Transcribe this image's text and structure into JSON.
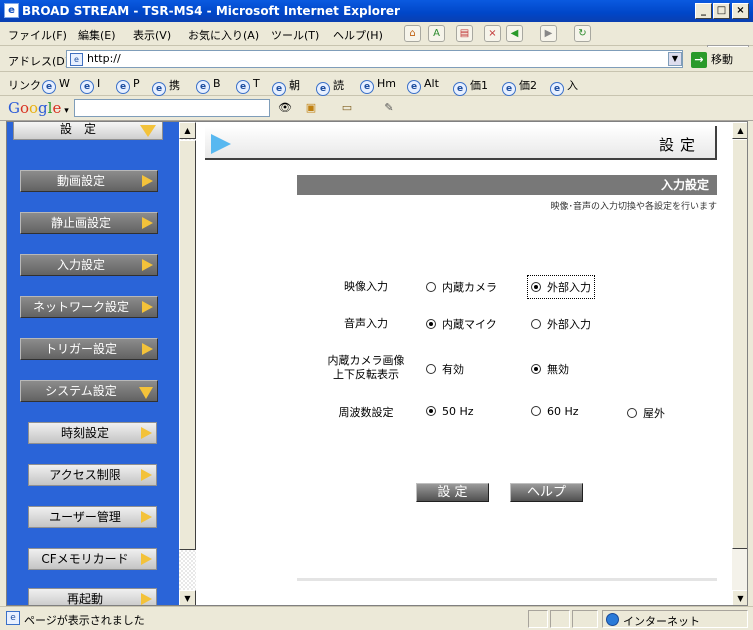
{
  "window": {
    "title": "BROAD STREAM - TSR-MS4 - Microsoft Internet Explorer",
    "min": "_",
    "max": "□",
    "close": "×"
  },
  "menubar": {
    "items": [
      "ファイル(F)",
      "編集(E)",
      "表示(V)",
      "お気に入り(A)",
      "ツール(T)",
      "ヘルプ(H)"
    ]
  },
  "address": {
    "label": "アドレス(D)",
    "value": "http://",
    "go_label": "移動"
  },
  "links": {
    "label": "リンク",
    "items": [
      "W",
      "I",
      "P",
      "携",
      "B",
      "T",
      "朝",
      "読",
      "Hm",
      "Alt",
      "価1",
      "価2",
      "入"
    ]
  },
  "google": {
    "logo": "Google",
    "search_value": ""
  },
  "sidebar": {
    "top_section": "設　定",
    "items": [
      "動画設定",
      "静止画設定",
      "入力設定",
      "ネットワーク設定",
      "トリガー設定",
      "システム設定"
    ],
    "subitems": [
      "時刻設定",
      "アクセス制限",
      "ユーザー管理",
      "CFメモリカード",
      "再起動"
    ]
  },
  "main": {
    "header_title": "設定",
    "section_title": "入力設定",
    "section_desc": "映像･音声の入力切換や各設定を行います",
    "rows": [
      {
        "label": "映像入力",
        "options": [
          "内蔵カメラ",
          "外部入力"
        ],
        "selected": 1
      },
      {
        "label": "音声入力",
        "options": [
          "内蔵マイク",
          "外部入力"
        ],
        "selected": 0
      },
      {
        "label": "内蔵カメラ画像\n上下反転表示",
        "label_line1": "内蔵カメラ画像",
        "label_line2": "上下反転表示",
        "options": [
          "有効",
          "無効"
        ],
        "selected": 1
      },
      {
        "label": "周波数設定",
        "options": [
          "50 Hz",
          "60 Hz",
          "屋外"
        ],
        "selected": 0
      }
    ],
    "buttons": {
      "set": "設 定",
      "help": "ヘルプ"
    }
  },
  "status": {
    "text": "ページが表示されました",
    "zone": "インターネット"
  }
}
